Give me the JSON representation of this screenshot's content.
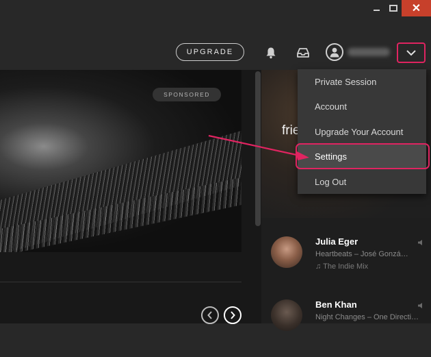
{
  "window": {
    "close_glyph": "✕"
  },
  "header": {
    "upgrade_label": "UPGRADE",
    "icons": [
      "bell-icon",
      "inbox-icon",
      "user-icon",
      "chevron-down-icon"
    ]
  },
  "ad": {
    "sponsored_label": "SPONSORED"
  },
  "friends_panel": {
    "banner_text": "frie",
    "friends": [
      {
        "name": "Julia Eger",
        "track": "Heartbeats – José Gonzá…",
        "source": "The Indie Mix"
      },
      {
        "name": "Ben Khan",
        "track": "Night Changes – One Directi…",
        "source": ""
      }
    ]
  },
  "user_menu": {
    "items": [
      {
        "label": "Private Session"
      },
      {
        "label": "Account"
      },
      {
        "label": "Upgrade Your Account"
      },
      {
        "label": "Settings",
        "active": true
      },
      {
        "label": "Log Out"
      }
    ]
  },
  "colors": {
    "highlight": "#e02461",
    "close_button": "#c7402b",
    "background": "#282828"
  }
}
